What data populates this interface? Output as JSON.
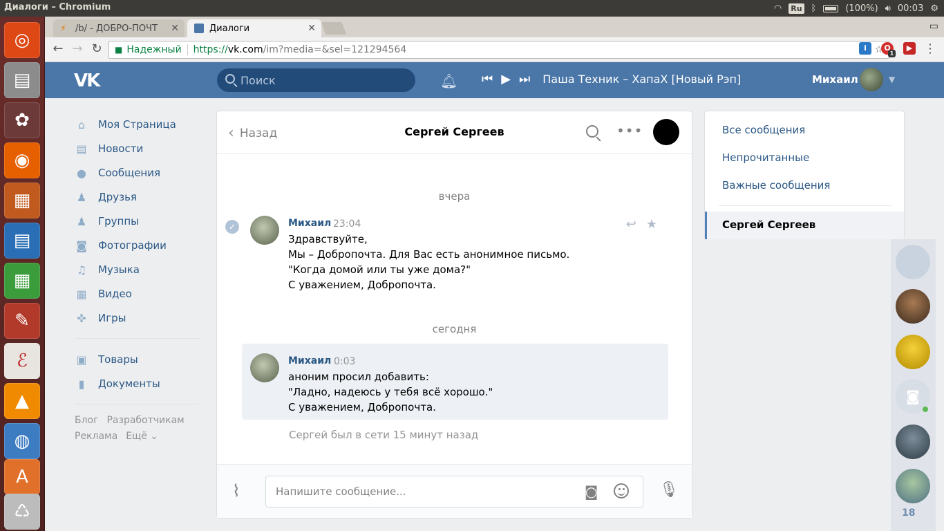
{
  "os": {
    "window_title": "Диалоги – Chromium",
    "keyboard_layout": "Ru",
    "battery": "(100%)",
    "clock": "00:03"
  },
  "browser": {
    "tabs": [
      {
        "label": "/b/ - ДОБРО-ПОЧТ",
        "active": false
      },
      {
        "label": "Диалоги",
        "active": true
      }
    ],
    "secure_label": "Надежный",
    "url_scheme": "https://",
    "url_host": "vk.com",
    "url_path": "/im?media=&sel=121294564",
    "extension_badge": "1"
  },
  "vk": {
    "search_placeholder": "Поиск",
    "now_playing": "Паша Техник – ХапаХ [Новый Рэп]",
    "user_name": "Михаил",
    "nav": [
      {
        "label": "Моя Страница",
        "icon": "home-icon"
      },
      {
        "label": "Новости",
        "icon": "news-icon"
      },
      {
        "label": "Сообщения",
        "icon": "messages-icon"
      },
      {
        "label": "Друзья",
        "icon": "friends-icon"
      },
      {
        "label": "Группы",
        "icon": "groups-icon"
      },
      {
        "label": "Фотографии",
        "icon": "camera-icon"
      },
      {
        "label": "Музыка",
        "icon": "music-icon"
      },
      {
        "label": "Видео",
        "icon": "video-icon"
      },
      {
        "label": "Игры",
        "icon": "gamepad-icon"
      }
    ],
    "nav2": [
      {
        "label": "Товары",
        "icon": "bag-icon"
      },
      {
        "label": "Документы",
        "icon": "document-icon"
      }
    ],
    "footer": [
      "Блог",
      "Разработчикам",
      "Реклама",
      "Ещё ⌄"
    ],
    "dialog": {
      "back_label": "Назад",
      "title": "Сергей Сергеев",
      "date_yesterday": "вчера",
      "date_today": "сегодня",
      "messages": [
        {
          "author": "Михаил",
          "time": "23:04",
          "lines": [
            "Здравствуйте,",
            "Мы – Добропочта. Для Вас есть анонимное письмо.",
            "\"Когда домой или ты уже дома?\"",
            "С уважением, Добропочта."
          ]
        },
        {
          "author": "Михаил",
          "time": "0:03",
          "lines": [
            "аноним просил добавить:",
            "\"Ладно, надеюсь у тебя всё хорошо.\"",
            "С уважением, Добропочта."
          ]
        }
      ],
      "last_seen": "Сергей был в сети 15 минут назад",
      "composer_placeholder": "Напишите сообщение..."
    },
    "filters": [
      "Все сообщения",
      "Непрочитанные",
      "Важные сообщения"
    ],
    "selected_chat": "Сергей Сергеев",
    "chat_count": "18"
  }
}
